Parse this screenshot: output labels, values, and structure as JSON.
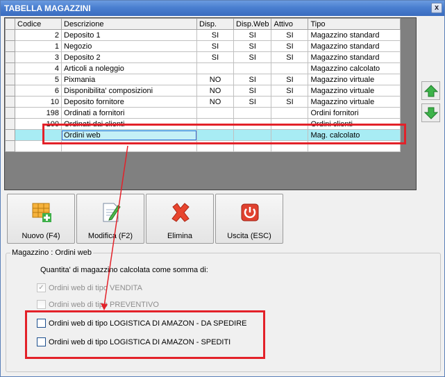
{
  "window": {
    "title": "TABELLA MAGAZZINI",
    "close_glyph": "x"
  },
  "grid": {
    "columns": [
      "Codice",
      "Descrizione",
      "Disp.",
      "Disp.Web",
      "Attivo",
      "Tipo"
    ],
    "rows": [
      {
        "codice": "2",
        "descrizione": "Deposito 1",
        "disp": "SI",
        "disp_web": "SI",
        "attivo": "SI",
        "tipo": "Magazzino standard"
      },
      {
        "codice": "1",
        "descrizione": "Negozio",
        "disp": "SI",
        "disp_web": "SI",
        "attivo": "SI",
        "tipo": "Magazzino standard"
      },
      {
        "codice": "3",
        "descrizione": "Deposito 2",
        "disp": "SI",
        "disp_web": "SI",
        "attivo": "SI",
        "tipo": "Magazzino standard"
      },
      {
        "codice": "4",
        "descrizione": "Articoli a noleggio",
        "disp": "",
        "disp_web": "",
        "attivo": "",
        "tipo": "Magazzino calcolato"
      },
      {
        "codice": "5",
        "descrizione": "Pixmania",
        "disp": "NO",
        "disp_web": "SI",
        "attivo": "SI",
        "tipo": "Magazzino virtuale"
      },
      {
        "codice": "6",
        "descrizione": "Disponibilita' composizioni",
        "disp": "NO",
        "disp_web": "SI",
        "attivo": "SI",
        "tipo": "Magazzino virtuale"
      },
      {
        "codice": "10",
        "descrizione": "Deposito fornitore",
        "disp": "NO",
        "disp_web": "SI",
        "attivo": "SI",
        "tipo": "Magazzino virtuale"
      },
      {
        "codice": "198",
        "descrizione": "Ordinati a fornitori",
        "disp": "",
        "disp_web": "",
        "attivo": "",
        "tipo": "Ordini fornitori"
      },
      {
        "codice": "100",
        "descrizione": "Ordinati dai clienti",
        "disp": "",
        "disp_web": "",
        "attivo": "",
        "tipo": "Ordini clienti"
      },
      {
        "codice": "",
        "descrizione": "Ordini web",
        "disp": "",
        "disp_web": "",
        "attivo": "",
        "tipo": "Mag. calcolato",
        "selected": true
      },
      {
        "codice": "",
        "descrizione": "",
        "disp": "",
        "disp_web": "",
        "attivo": "",
        "tipo": ""
      }
    ]
  },
  "side_buttons": {
    "up_icon": "arrow-up-icon",
    "down_icon": "arrow-down-icon"
  },
  "toolbar": {
    "nuovo": "Nuovo (F4)",
    "modifica": "Modifica (F2)",
    "elimina": "Elimina",
    "uscita": "Uscita (ESC)"
  },
  "group": {
    "legend": "Magazzino : Ordini web",
    "intro": "Quantita' di magazzino calcolata come somma di:",
    "options": [
      {
        "label": "Ordini web di tipo VENDITA",
        "checked": true,
        "enabled": false
      },
      {
        "label": "Ordini web di tipo PREVENTIVO",
        "checked": false,
        "enabled": false
      },
      {
        "label": "Ordini web di tipo LOGISTICA DI AMAZON - DA SPEDIRE",
        "checked": false,
        "enabled": true
      },
      {
        "label": "Ordini web di tipo LOGISTICA DI AMAZON - SPEDITI",
        "checked": false,
        "enabled": true
      }
    ]
  },
  "colors": {
    "annotation": "#e32129",
    "selection": "#a8ecf4",
    "title_bar": "#4a7fd0"
  }
}
